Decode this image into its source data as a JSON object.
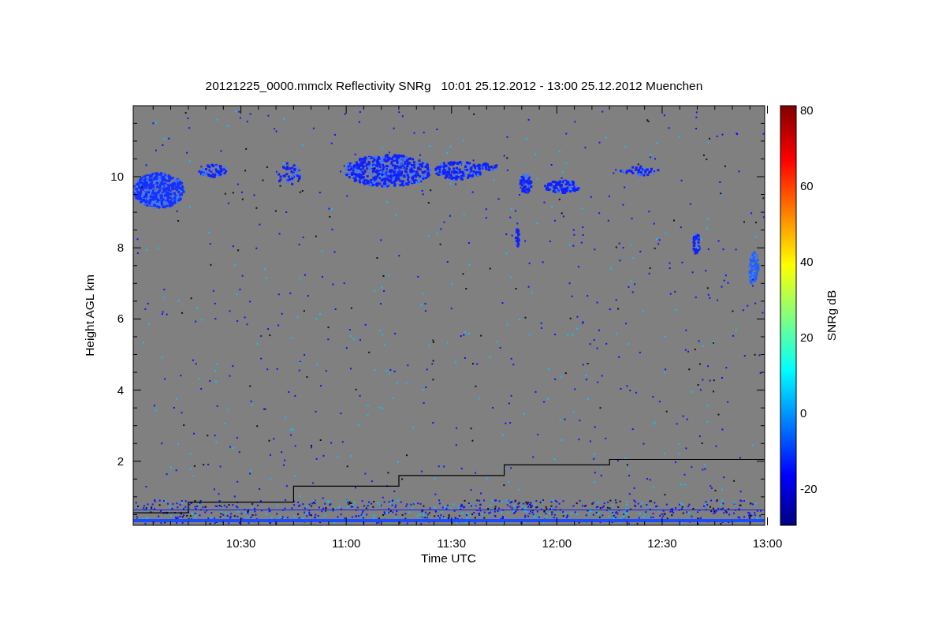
{
  "title": "20121225_0000.mmclx Reflectivity SNRg   10:01 25.12.2012 - 13:00 25.12.2012 Muenchen",
  "y_axis": {
    "label": "Height AGL km",
    "ticks": [
      "10",
      "8",
      "6",
      "4",
      "2"
    ]
  },
  "x_axis": {
    "label": "Time UTC",
    "ticks": [
      "10:30",
      "11:00",
      "11:30",
      "12:00",
      "12:30",
      "13:00"
    ]
  },
  "colorbar": {
    "label": "SNRg dB",
    "ticks": [
      "80",
      "60",
      "40",
      "20",
      "0",
      "-20"
    ]
  }
}
